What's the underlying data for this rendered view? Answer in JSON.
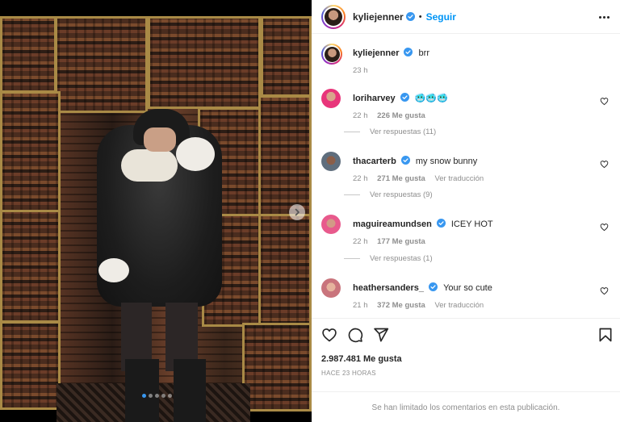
{
  "post": {
    "author": "kyliejenner",
    "follow_label": "Seguir",
    "separator": "•",
    "caption": "brr",
    "caption_time": "23 h",
    "likes": "2.987.481 Me gusta",
    "posted_ago": "HACE 23 HORAS",
    "comments_limited": "Se han limitado los comentarios en esta publicación."
  },
  "comments": [
    {
      "user": "loriharvey",
      "verified": true,
      "text": "🥶🥶🥶",
      "time": "22 h",
      "likes": "226 Me gusta",
      "translate": "",
      "replies": "Ver respuestas (11)"
    },
    {
      "user": "thacarterb",
      "verified": true,
      "text": "my snow bunny",
      "time": "22 h",
      "likes": "271 Me gusta",
      "translate": "Ver traducción",
      "replies": "Ver respuestas (9)"
    },
    {
      "user": "maguireamundsen",
      "verified": true,
      "text": "ICEY HOT",
      "time": "22 h",
      "likes": "177 Me gusta",
      "translate": "",
      "replies": "Ver respuestas (1)"
    },
    {
      "user": "heathersanders_",
      "verified": true,
      "text": "Your so cute",
      "time": "21 h",
      "likes": "372 Me gusta",
      "translate": "Ver traducción",
      "replies": ""
    }
  ],
  "icons": {
    "verified": "verified-badge-icon",
    "more": "more-options-icon",
    "like": "heart-icon",
    "comment": "comment-icon",
    "share": "share-icon",
    "save": "bookmark-icon",
    "next": "chevron-right-icon"
  },
  "colors": {
    "accent": "#0095f6",
    "verified": "#3897f0",
    "secondary_text": "#8e8e8e"
  }
}
